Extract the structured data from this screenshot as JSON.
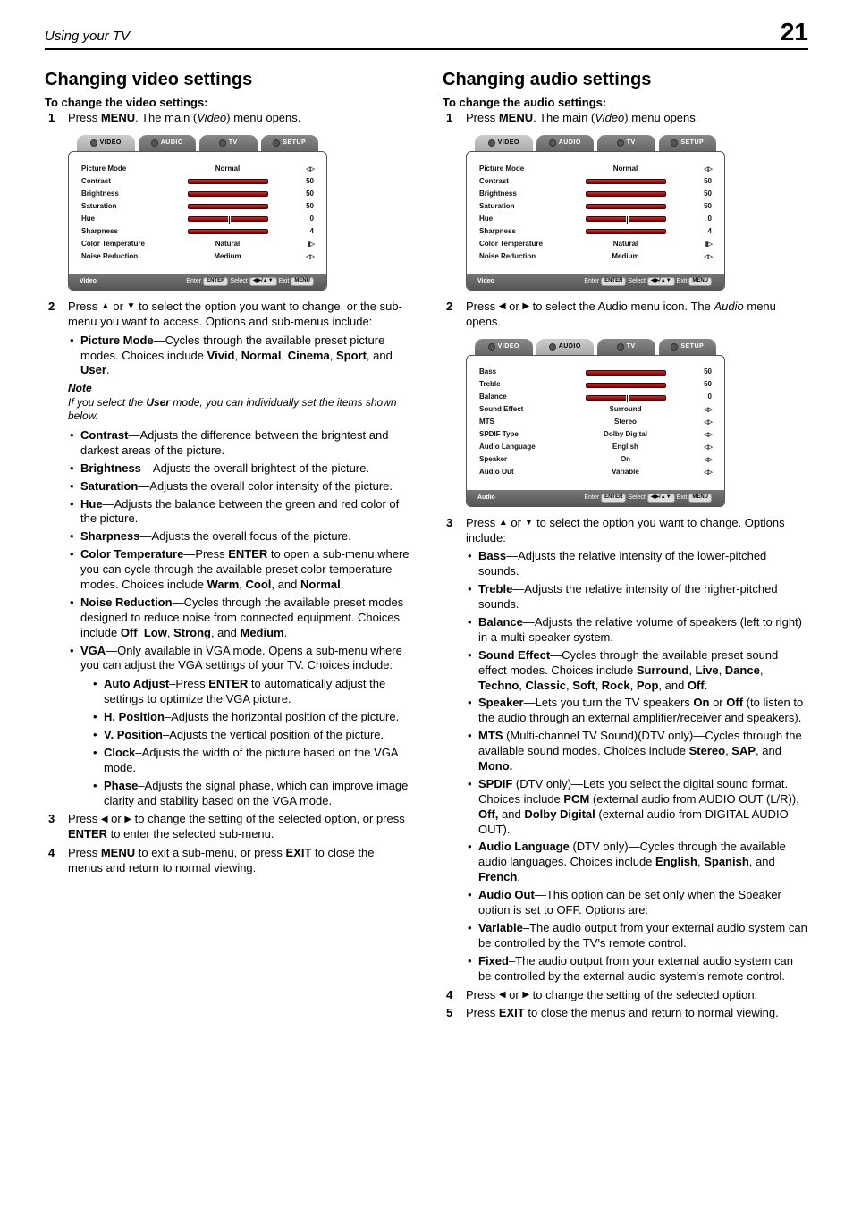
{
  "page": {
    "chapter": "Using your TV",
    "number": "21"
  },
  "left": {
    "title": "Changing video settings",
    "subhead": "To change the video settings:",
    "step1_a": "Press ",
    "step1_b": "MENU",
    "step1_c": ". The main (",
    "step1_d": "Video",
    "step1_e": ") menu opens.",
    "step2_a": "Press ",
    "step2_b": " or ",
    "step2_c": " to select the option you want to change, or the sub-menu you want to access. Options and sub-menus include:",
    "b_picmode_a": "Picture Mode",
    "b_picmode_b": "—Cycles through the available preset picture modes. Choices include ",
    "b_picmode_c": "Vivid",
    "b_picmode_d": ", ",
    "b_picmode_e": "Normal",
    "b_picmode_f": ", ",
    "b_picmode_g": "Cinema",
    "b_picmode_h": ", ",
    "b_picmode_i": "Sport",
    "b_picmode_j": ", and ",
    "b_picmode_k": "User",
    "b_picmode_l": ".",
    "note_head": "Note",
    "note_body_a": "If you select the ",
    "note_body_b": "User",
    "note_body_c": " mode, you can individually set the items shown below.",
    "b_contrast_a": "Contrast",
    "b_contrast_b": "—Adjusts the difference between the brightest and darkest areas of the picture.",
    "b_bright_a": "Brightness",
    "b_bright_b": "—Adjusts the overall brightest of the picture.",
    "b_sat_a": "Saturation",
    "b_sat_b": "—Adjusts the overall color intensity of the picture.",
    "b_hue_a": "Hue",
    "b_hue_b": "—Adjusts the balance between the green and red color of the picture.",
    "b_sharp_a": "Sharpness",
    "b_sharp_b": "—Adjusts the overall focus of the picture.",
    "b_ct_a": "Color Temperature",
    "b_ct_b": "—Press ",
    "b_ct_c": "ENTER",
    "b_ct_d": " to open a sub-menu where you can cycle through the available preset color temperature modes. Choices include ",
    "b_ct_e": "Warm",
    "b_ct_f": ", ",
    "b_ct_g": "Cool",
    "b_ct_h": ", and ",
    "b_ct_i": "Normal",
    "b_ct_j": ".",
    "b_nr_a": "Noise Reduction",
    "b_nr_b": "—Cycles through the available preset modes designed to reduce noise from connected equipment. Choices include ",
    "b_nr_c": "Off",
    "b_nr_d": ", ",
    "b_nr_e": "Low",
    "b_nr_f": ", ",
    "b_nr_g": "Strong",
    "b_nr_h": ", and ",
    "b_nr_i": "Medium",
    "b_nr_j": ".",
    "b_vga_a": "VGA",
    "b_vga_b": "—Only available in VGA mode. Opens a sub-menu where you can adjust the VGA settings of your TV. Choices include:",
    "b_auto_a": "Auto Adjust",
    "b_auto_b": "–Press ",
    "b_auto_c": "ENTER",
    "b_auto_d": " to automatically adjust the settings to optimize the VGA picture.",
    "b_hpos_a": "H. Position",
    "b_hpos_b": "–Adjusts the horizontal position of the picture.",
    "b_vpos_a": "V. Position",
    "b_vpos_b": "–Adjusts the vertical position of the picture.",
    "b_clock_a": "Clock",
    "b_clock_b": "–Adjusts the width of the picture based on the VGA mode.",
    "b_phase_a": "Phase",
    "b_phase_b": "–Adjusts the signal phase, which can improve image clarity and stability based on the VGA mode.",
    "step3_a": "Press ",
    "step3_b": " or ",
    "step3_c": " to change the setting of the selected option, or press ",
    "step3_d": "ENTER",
    "step3_e": " to enter the selected sub-menu.",
    "step4_a": "Press ",
    "step4_b": "MENU",
    "step4_c": " to exit a sub-menu, or press ",
    "step4_d": "EXIT",
    "step4_e": " to close the menus and return to normal viewing."
  },
  "right": {
    "title": "Changing audio settings",
    "subhead": "To change the audio settings:",
    "step1_a": "Press ",
    "step1_b": "MENU",
    "step1_c": ". The main (",
    "step1_d": "Video",
    "step1_e": ") menu opens.",
    "step2_a": "Press ",
    "step2_b": " or ",
    "step2_c": " to select the Audio menu icon. The ",
    "step2_d": "Audio",
    "step2_e": " menu opens.",
    "step3_a": "Press ",
    "step3_b": " or ",
    "step3_c": " to select the option you want to change. Options include:",
    "b_bass_a": "Bass",
    "b_bass_b": "—Adjusts the relative intensity of the lower-pitched sounds.",
    "b_treble_a": "Treble",
    "b_treble_b": "—Adjusts the relative intensity of the higher-pitched sounds.",
    "b_bal_a": "Balance",
    "b_bal_b": "—Adjusts the relative volume of speakers (left to right) in a multi-speaker system.",
    "b_se_a": "Sound Effect",
    "b_se_b": "—Cycles through the available preset sound effect modes. Choices include ",
    "b_se_c": "Surround",
    "b_se_d": ", ",
    "b_se_e": "Live",
    "b_se_f": ", ",
    "b_se_g": "Dance",
    "b_se_h": ", ",
    "b_se_i": "Techno",
    "b_se_j": ", ",
    "b_se_k": "Classic",
    "b_se_l": ", ",
    "b_se_m": "Soft",
    "b_se_n": ", ",
    "b_se_o": "Rock",
    "b_se_p": ", ",
    "b_se_q": "Pop",
    "b_se_r": ", and ",
    "b_se_s": "Off",
    "b_se_t": ".",
    "b_spk_a": "Speaker",
    "b_spk_b": "—Lets you turn the TV speakers ",
    "b_spk_c": "On",
    "b_spk_d": " or ",
    "b_spk_e": "Off",
    "b_spk_f": " (to listen to the audio through an external amplifier/receiver and speakers).",
    "b_mts_a": "MTS",
    "b_mts_b": " (Multi-channel TV Sound)(DTV only)—Cycles through the available sound modes. Choices include ",
    "b_mts_c": "Stereo",
    "b_mts_d": ", ",
    "b_mts_e": "SAP",
    "b_mts_f": ", and ",
    "b_mts_g": "Mono.",
    "b_spdif_a": "SPDIF",
    "b_spdif_b": " (DTV only)—Lets you select the digital sound format. Choices include ",
    "b_spdif_c": "PCM",
    "b_spdif_d": " (external audio from AUDIO OUT (L/R)), ",
    "b_spdif_e": "Off,",
    "b_spdif_f": " and ",
    "b_spdif_g": "Dolby Digital",
    "b_spdif_h": " (external audio from DIGITAL AUDIO OUT).",
    "b_alang_a": "Audio Language",
    "b_alang_b": " (DTV only)—Cycles through the available audio languages. Choices include ",
    "b_alang_c": "English",
    "b_alang_d": ", ",
    "b_alang_e": "Spanish",
    "b_alang_f": ", and ",
    "b_alang_g": "French",
    "b_alang_h": ".",
    "b_aout_a": "Audio Out",
    "b_aout_b": "—This option can be set only when the Speaker option is set to OFF. Options are:",
    "b_var_a": "Variable",
    "b_var_b": "–The audio output from your external audio system can be controlled by the TV's remote control.",
    "b_fix_a": "Fixed",
    "b_fix_b": "–The audio output from your external audio system can be controlled by the external audio system's remote control.",
    "step4_a": "Press ",
    "step4_b": " or ",
    "step4_c": " to change the setting of the selected option.",
    "step5_a": "Press ",
    "step5_b": "EXIT",
    "step5_c": " to close the menus and return to normal viewing."
  },
  "osd_video": {
    "tabs": [
      "VIDEO",
      "AUDIO",
      "TV",
      "SETUP"
    ],
    "active": 0,
    "rows": [
      {
        "label": "Picture Mode",
        "type": "text",
        "mid": "Normal",
        "val": "",
        "arrows": "lr"
      },
      {
        "label": "Contrast",
        "type": "slider",
        "pos": 50,
        "val": "50"
      },
      {
        "label": "Brightness",
        "type": "slider",
        "pos": 50,
        "val": "50"
      },
      {
        "label": "Saturation",
        "type": "slider",
        "pos": 50,
        "val": "50"
      },
      {
        "label": "Hue",
        "type": "slider",
        "pos": 50,
        "val": "0",
        "thumb": true
      },
      {
        "label": "Sharpness",
        "type": "slider",
        "pos": 25,
        "val": "4"
      },
      {
        "label": "Color Temperature",
        "type": "text",
        "mid": "Natural",
        "val": "",
        "arrows": "lrsolid"
      },
      {
        "label": "Noise Reduction",
        "type": "text",
        "mid": "Medium",
        "val": "",
        "arrows": "lr"
      }
    ],
    "footer_label": "Video",
    "footer_hints": [
      "Enter",
      "ENTER",
      "Select",
      "◀▶/▲▼",
      "Exit",
      "MENU"
    ]
  },
  "osd_audio": {
    "tabs": [
      "VIDEO",
      "AUDIO",
      "TV",
      "SETUP"
    ],
    "active": 1,
    "rows": [
      {
        "label": "Bass",
        "type": "slider",
        "pos": 50,
        "val": "50"
      },
      {
        "label": "Treble",
        "type": "slider",
        "pos": 50,
        "val": "50"
      },
      {
        "label": "Balance",
        "type": "slider",
        "pos": 50,
        "val": "0",
        "thumb": true
      },
      {
        "label": "Sound Effect",
        "type": "text",
        "mid": "Surround",
        "val": "",
        "arrows": "lr"
      },
      {
        "label": "MTS",
        "type": "text",
        "mid": "Stereo",
        "val": "",
        "arrows": "lr"
      },
      {
        "label": "SPDIF Type",
        "type": "text",
        "mid": "Dolby Digital",
        "val": "",
        "arrows": "lr"
      },
      {
        "label": "Audio Language",
        "type": "text",
        "mid": "English",
        "val": "",
        "arrows": "lr"
      },
      {
        "label": "Speaker",
        "type": "text",
        "mid": "On",
        "val": "",
        "arrows": "lr"
      },
      {
        "label": "Audio Out",
        "type": "text",
        "mid": "Variable",
        "val": "",
        "arrows": "lr"
      }
    ],
    "footer_label": "Audio",
    "footer_hints": [
      "Enter",
      "ENTER",
      "Select",
      "◀▶/▲▼",
      "Exit",
      "MENU"
    ]
  }
}
